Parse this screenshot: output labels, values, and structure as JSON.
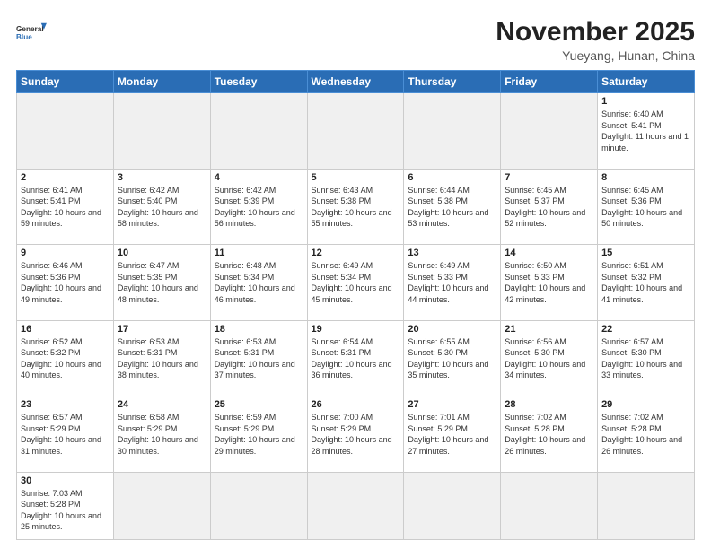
{
  "header": {
    "logo_general": "General",
    "logo_blue": "Blue",
    "month_title": "November 2025",
    "location": "Yueyang, Hunan, China"
  },
  "weekdays": [
    "Sunday",
    "Monday",
    "Tuesday",
    "Wednesday",
    "Thursday",
    "Friday",
    "Saturday"
  ],
  "weeks": [
    [
      {
        "day": "",
        "info": ""
      },
      {
        "day": "",
        "info": ""
      },
      {
        "day": "",
        "info": ""
      },
      {
        "day": "",
        "info": ""
      },
      {
        "day": "",
        "info": ""
      },
      {
        "day": "",
        "info": ""
      },
      {
        "day": "1",
        "info": "Sunrise: 6:40 AM\nSunset: 5:41 PM\nDaylight: 11 hours and 1 minute."
      }
    ],
    [
      {
        "day": "2",
        "info": "Sunrise: 6:41 AM\nSunset: 5:41 PM\nDaylight: 10 hours and 59 minutes."
      },
      {
        "day": "3",
        "info": "Sunrise: 6:42 AM\nSunset: 5:40 PM\nDaylight: 10 hours and 58 minutes."
      },
      {
        "day": "4",
        "info": "Sunrise: 6:42 AM\nSunset: 5:39 PM\nDaylight: 10 hours and 56 minutes."
      },
      {
        "day": "5",
        "info": "Sunrise: 6:43 AM\nSunset: 5:38 PM\nDaylight: 10 hours and 55 minutes."
      },
      {
        "day": "6",
        "info": "Sunrise: 6:44 AM\nSunset: 5:38 PM\nDaylight: 10 hours and 53 minutes."
      },
      {
        "day": "7",
        "info": "Sunrise: 6:45 AM\nSunset: 5:37 PM\nDaylight: 10 hours and 52 minutes."
      },
      {
        "day": "8",
        "info": "Sunrise: 6:45 AM\nSunset: 5:36 PM\nDaylight: 10 hours and 50 minutes."
      }
    ],
    [
      {
        "day": "9",
        "info": "Sunrise: 6:46 AM\nSunset: 5:36 PM\nDaylight: 10 hours and 49 minutes."
      },
      {
        "day": "10",
        "info": "Sunrise: 6:47 AM\nSunset: 5:35 PM\nDaylight: 10 hours and 48 minutes."
      },
      {
        "day": "11",
        "info": "Sunrise: 6:48 AM\nSunset: 5:34 PM\nDaylight: 10 hours and 46 minutes."
      },
      {
        "day": "12",
        "info": "Sunrise: 6:49 AM\nSunset: 5:34 PM\nDaylight: 10 hours and 45 minutes."
      },
      {
        "day": "13",
        "info": "Sunrise: 6:49 AM\nSunset: 5:33 PM\nDaylight: 10 hours and 44 minutes."
      },
      {
        "day": "14",
        "info": "Sunrise: 6:50 AM\nSunset: 5:33 PM\nDaylight: 10 hours and 42 minutes."
      },
      {
        "day": "15",
        "info": "Sunrise: 6:51 AM\nSunset: 5:32 PM\nDaylight: 10 hours and 41 minutes."
      }
    ],
    [
      {
        "day": "16",
        "info": "Sunrise: 6:52 AM\nSunset: 5:32 PM\nDaylight: 10 hours and 40 minutes."
      },
      {
        "day": "17",
        "info": "Sunrise: 6:53 AM\nSunset: 5:31 PM\nDaylight: 10 hours and 38 minutes."
      },
      {
        "day": "18",
        "info": "Sunrise: 6:53 AM\nSunset: 5:31 PM\nDaylight: 10 hours and 37 minutes."
      },
      {
        "day": "19",
        "info": "Sunrise: 6:54 AM\nSunset: 5:31 PM\nDaylight: 10 hours and 36 minutes."
      },
      {
        "day": "20",
        "info": "Sunrise: 6:55 AM\nSunset: 5:30 PM\nDaylight: 10 hours and 35 minutes."
      },
      {
        "day": "21",
        "info": "Sunrise: 6:56 AM\nSunset: 5:30 PM\nDaylight: 10 hours and 34 minutes."
      },
      {
        "day": "22",
        "info": "Sunrise: 6:57 AM\nSunset: 5:30 PM\nDaylight: 10 hours and 33 minutes."
      }
    ],
    [
      {
        "day": "23",
        "info": "Sunrise: 6:57 AM\nSunset: 5:29 PM\nDaylight: 10 hours and 31 minutes."
      },
      {
        "day": "24",
        "info": "Sunrise: 6:58 AM\nSunset: 5:29 PM\nDaylight: 10 hours and 30 minutes."
      },
      {
        "day": "25",
        "info": "Sunrise: 6:59 AM\nSunset: 5:29 PM\nDaylight: 10 hours and 29 minutes."
      },
      {
        "day": "26",
        "info": "Sunrise: 7:00 AM\nSunset: 5:29 PM\nDaylight: 10 hours and 28 minutes."
      },
      {
        "day": "27",
        "info": "Sunrise: 7:01 AM\nSunset: 5:29 PM\nDaylight: 10 hours and 27 minutes."
      },
      {
        "day": "28",
        "info": "Sunrise: 7:02 AM\nSunset: 5:28 PM\nDaylight: 10 hours and 26 minutes."
      },
      {
        "day": "29",
        "info": "Sunrise: 7:02 AM\nSunset: 5:28 PM\nDaylight: 10 hours and 26 minutes."
      }
    ],
    [
      {
        "day": "30",
        "info": "Sunrise: 7:03 AM\nSunset: 5:28 PM\nDaylight: 10 hours and 25 minutes."
      },
      {
        "day": "",
        "info": ""
      },
      {
        "day": "",
        "info": ""
      },
      {
        "day": "",
        "info": ""
      },
      {
        "day": "",
        "info": ""
      },
      {
        "day": "",
        "info": ""
      },
      {
        "day": "",
        "info": ""
      }
    ]
  ]
}
